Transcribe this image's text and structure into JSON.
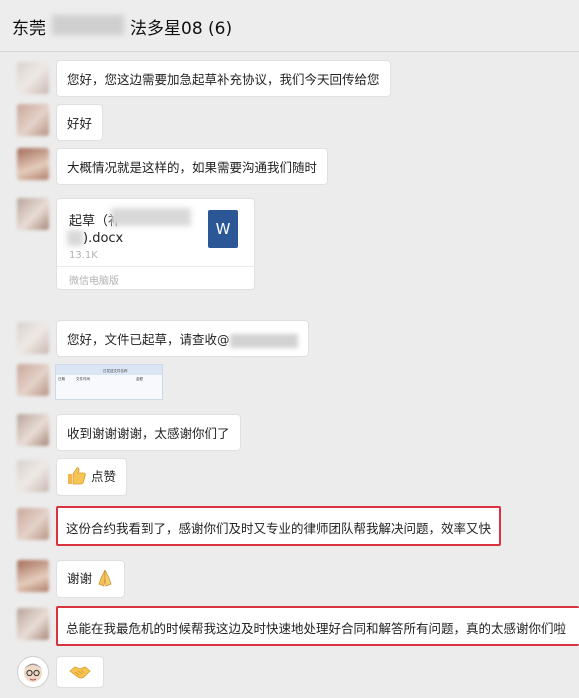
{
  "header": {
    "title_prefix": "东莞",
    "title_suffix": "法多星08 (6)"
  },
  "messages": {
    "m1": "您好，您这边需要加急起草补充协议，我们今天回传给您",
    "m2": "好好",
    "m3": "大概情况就是这样的，如果需要沟通我们随时",
    "file": {
      "name_line1": "起草（补",
      "name_line2": ").docx",
      "size": "13.1K",
      "source": "微信电脑版",
      "icon_letter": "W"
    },
    "m5": "您好，文件已起草，请查收@",
    "thumb_cells": [
      "日期",
      "文件时间",
      "日发送文件名称",
      "金额"
    ],
    "m6": "收到谢谢谢谢，太感谢你们了",
    "m7": "点赞",
    "m8": "这份合约我看到了，感谢你们及时又专业的律师团队帮我解决问题，效率又快",
    "m9": "谢谢",
    "m10": "总能在我最危机的时候帮我这边及时快速地处理好合同和解答所有问题，真的太感谢你们啦"
  },
  "icons": {
    "thumbs_up": "thumbs-up-icon",
    "praying_hands": "praying-hands-icon",
    "handshake": "handshake-icon",
    "word_file": "word-file-icon"
  },
  "colors": {
    "highlight_border": "#d8333f",
    "word_blue": "#2b5797"
  }
}
